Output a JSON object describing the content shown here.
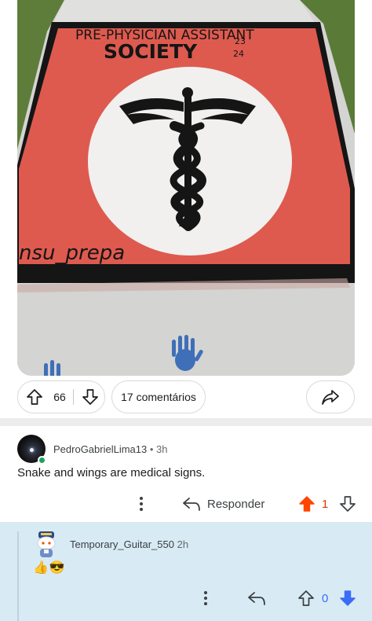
{
  "post_image": {
    "painted_title_line1": "PRE-PHYSICIAN ASSISTANT",
    "painted_title_line2": "SOCIETY",
    "painted_year_top": "23",
    "painted_year_bottom": "24",
    "painted_handle": "nsu_prepa",
    "colors": {
      "red_panel": "#de5a4f",
      "sidewalk": "#d6d6d4",
      "grass": "#5f7d3a",
      "black_paint": "#151515",
      "white_paint": "#f1f0ee",
      "blue_handprint": "#3f6fb8"
    }
  },
  "post_actions": {
    "upvote_count": "66",
    "comments_label": "17 comentários",
    "icons": {
      "upvote": "upvote-outline-icon",
      "downvote": "downvote-outline-icon",
      "share": "share-arrow-icon"
    }
  },
  "comments": [
    {
      "username": "PedroGabrielLima13",
      "separator": "•",
      "time": "3h",
      "body": "Snake and wings are medical signs.",
      "reply_label": "Responder",
      "score": "1",
      "upvoted": true,
      "online": true,
      "colors": {
        "upvote_active": "#ff4500",
        "score_active": "#d93a00"
      }
    },
    {
      "username": "Temporary_Guitar_550",
      "time": "2h",
      "body": "👍😎",
      "score": "0",
      "downvoted": true,
      "highlighted": true,
      "colors": {
        "highlight_bg": "#d8eaf4",
        "downvote_active": "#3b6cf6"
      }
    }
  ]
}
